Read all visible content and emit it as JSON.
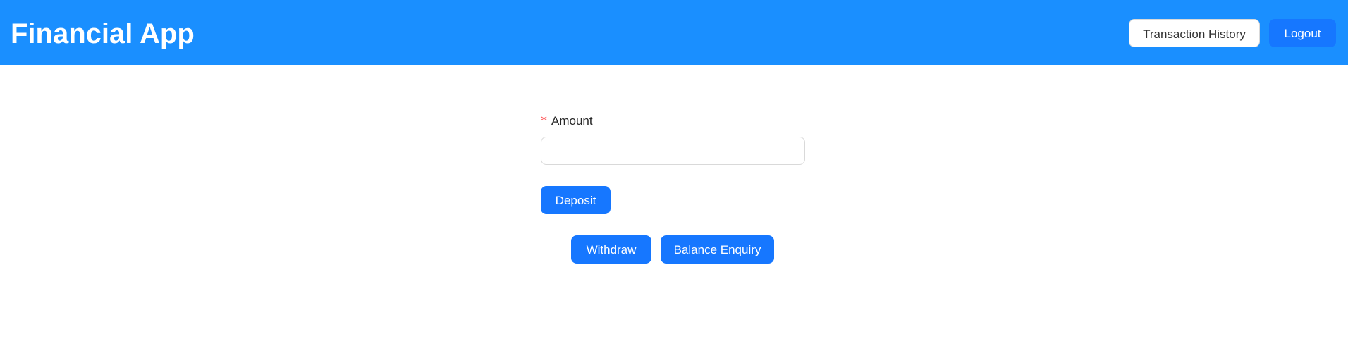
{
  "header": {
    "title": "Financial App",
    "transaction_history_label": "Transaction History",
    "logout_label": "Logout"
  },
  "form": {
    "required_mark": "*",
    "amount_label": "Amount",
    "amount_value": "",
    "deposit_label": "Deposit"
  },
  "actions": {
    "withdraw_label": "Withdraw",
    "balance_enquiry_label": "Balance Enquiry"
  },
  "colors": {
    "header_background": "#1a8fff",
    "primary_button": "#1677ff",
    "required_mark": "#ff4d4f"
  }
}
